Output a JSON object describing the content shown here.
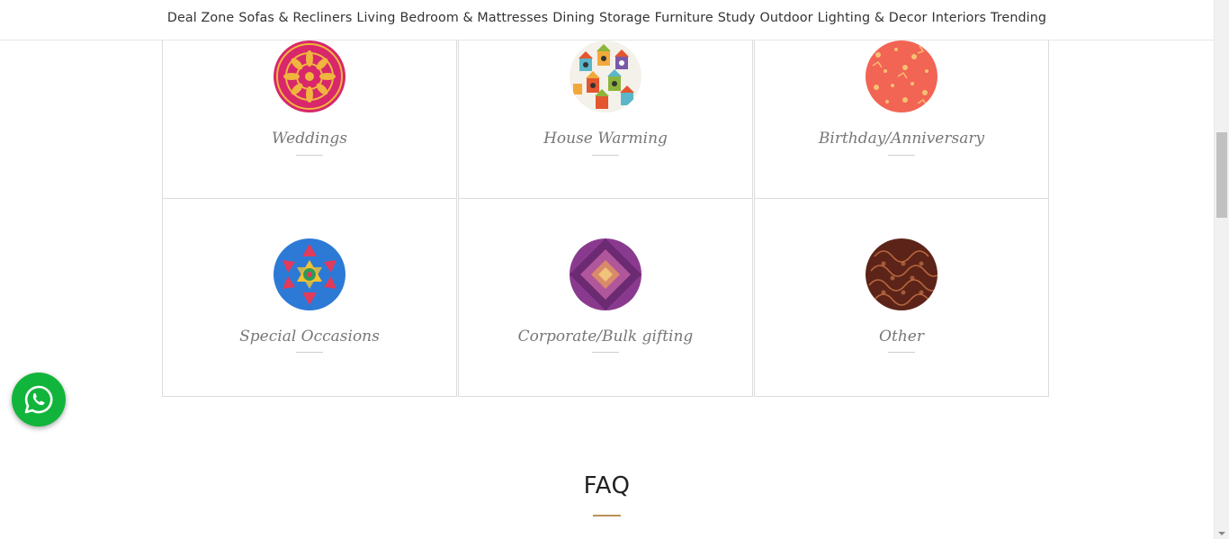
{
  "nav": {
    "items": [
      {
        "label": "Deal Zone"
      },
      {
        "label": "Sofas & Recliners"
      },
      {
        "label": "Living"
      },
      {
        "label": "Bedroom & Mattresses"
      },
      {
        "label": "Dining"
      },
      {
        "label": "Storage"
      },
      {
        "label": "Furniture"
      },
      {
        "label": "Study"
      },
      {
        "label": "Outdoor"
      },
      {
        "label": "Lighting & Decor"
      },
      {
        "label": "Interiors"
      },
      {
        "label": "Trending"
      }
    ]
  },
  "occasions": [
    {
      "label": "Weddings",
      "icon": "weddings-pattern-icon",
      "color": "#d8276a"
    },
    {
      "label": "House Warming",
      "icon": "birdhouse-pattern-icon",
      "color": "#f4f1ea"
    },
    {
      "label": "Birthday/Anniversary",
      "icon": "birthday-pattern-icon",
      "color": "#f26454"
    },
    {
      "label": "Special Occasions",
      "icon": "kaleidoscope-pattern-icon",
      "color": "#2c7ad6"
    },
    {
      "label": "Corporate/Bulk gifting",
      "icon": "geometric-pattern-icon",
      "color": "#8a3a8e"
    },
    {
      "label": "Other",
      "icon": "paisley-pattern-icon",
      "color": "#6b2a1c"
    }
  ],
  "faq": {
    "title": "FAQ",
    "accent_color": "#b8935a"
  },
  "whatsapp": {
    "icon": "whatsapp-icon",
    "color": "#12b53b"
  }
}
